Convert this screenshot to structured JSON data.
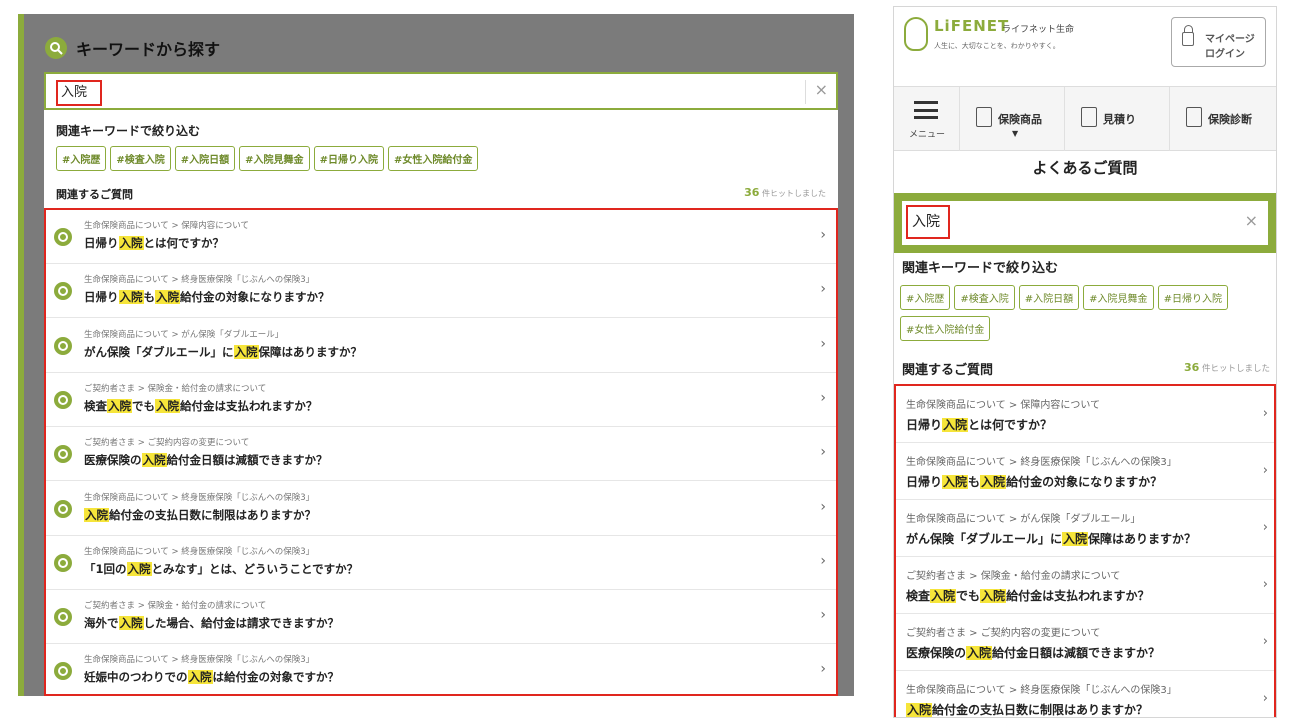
{
  "desktop": {
    "title": "キーワードから探す",
    "search": {
      "value": "入院",
      "clear_icon": "×"
    },
    "keywords_heading": "関連キーワードで絞り込む",
    "tags": [
      "#入院歴",
      "#検査入院",
      "#入院日額",
      "#入院見舞金",
      "#日帰り入院",
      "#女性入院給付金"
    ],
    "related_heading": "関連するご質問",
    "hit_count": "36",
    "hit_suffix": "件ヒットしました",
    "results": [
      {
        "category": "生命保険商品について > 保障内容について",
        "question": [
          "日帰り",
          "入院",
          "とは何ですか？"
        ]
      },
      {
        "category": "生命保険商品について > 終身医療保険「じぶんへの保険3」",
        "question": [
          "日帰り",
          "入院",
          "も",
          "入院",
          "給付金の対象になりますか？"
        ]
      },
      {
        "category": "生命保険商品について > がん保険「ダブルエール」",
        "question": [
          "がん保険「ダブルエール」に",
          "入院",
          "保障はありますか？"
        ]
      },
      {
        "category": "ご契約者さま > 保険金・給付金の請求について",
        "question": [
          "検査",
          "入院",
          "でも",
          "入院",
          "給付金は支払われますか？"
        ]
      },
      {
        "category": "ご契約者さま > ご契約内容の変更について",
        "question": [
          "医療保険の",
          "入院",
          "給付金日額は減額できますか？"
        ]
      },
      {
        "category": "生命保険商品について > 終身医療保険「じぶんへの保険3」",
        "question": [
          "",
          "入院",
          "給付金の支払日数に制限はありますか？"
        ]
      },
      {
        "category": "生命保険商品について > 終身医療保険「じぶんへの保険3」",
        "question": [
          "「1回の",
          "入院",
          "とみなす」とは、どういうことですか？"
        ]
      },
      {
        "category": "ご契約者さま > 保険金・給付金の請求について",
        "question": [
          "海外で",
          "入院",
          "した場合、給付金は請求できますか？"
        ]
      },
      {
        "category": "生命保険商品について > 終身医療保険「じぶんへの保険3」",
        "question": [
          "妊娠中のつわりでの",
          "入院",
          "は給付金の対象ですか？"
        ]
      }
    ]
  },
  "mobile": {
    "logo_text": "LiFENET",
    "logo_jp": "ライフネット生命",
    "tagline": "人生に、大切なことを、わかりやすく。",
    "mypage_line1": "マイページ",
    "mypage_line2": "ログイン",
    "nav": {
      "menu": "メニュー",
      "products": "保険商品",
      "estimate": "見積り",
      "diagnosis": "保険診断"
    },
    "faq_title": "よくあるご質問",
    "search": {
      "value": "入院",
      "clear_icon": "×"
    },
    "keywords_heading": "関連キーワードで絞り込む",
    "tags": [
      "#入院歴",
      "#検査入院",
      "#入院日額",
      "#入院見舞金",
      "#日帰り入院",
      "#女性入院給付金"
    ],
    "related_heading": "関連するご質問",
    "hit_count": "36",
    "hit_suffix": "件ヒットしました",
    "results": [
      {
        "category": "生命保険商品について > 保障内容について",
        "question": [
          "日帰り",
          "入院",
          "とは何ですか？"
        ]
      },
      {
        "category": "生命保険商品について > 終身医療保険「じぶんへの保険3」",
        "question": [
          "日帰り",
          "入院",
          "も",
          "入院",
          "給付金の対象になりますか？"
        ]
      },
      {
        "category": "生命保険商品について > がん保険「ダブルエール」",
        "question": [
          "がん保険「ダブルエール」に",
          "入院",
          "保障はありますか？"
        ]
      },
      {
        "category": "ご契約者さま > 保険金・給付金の請求について",
        "question": [
          "検査",
          "入院",
          "でも",
          "入院",
          "給付金は支払われますか？"
        ]
      },
      {
        "category": "ご契約者さま > ご契約内容の変更について",
        "question": [
          "医療保険の",
          "入院",
          "給付金日額は減額できますか？"
        ]
      },
      {
        "category": "生命保険商品について > 終身医療保険「じぶんへの保険3」",
        "question": [
          "",
          "入院",
          "給付金の支払日数に制限はありますか？"
        ]
      }
    ]
  }
}
